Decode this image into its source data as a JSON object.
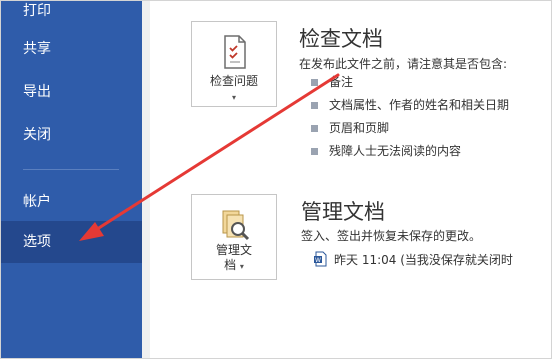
{
  "sidebar": {
    "items": [
      {
        "label": "打印"
      },
      {
        "label": "共享"
      },
      {
        "label": "导出"
      },
      {
        "label": "关闭"
      },
      {
        "label": "帐户"
      },
      {
        "label": "选项"
      }
    ],
    "selected": "选项",
    "bg_color": "#2f5caa",
    "selected_color": "#24488d"
  },
  "inspect": {
    "tile_label": "检查问题",
    "title": "检查文档",
    "description": "在发布此文件之前，请注意其是否包含:",
    "bullets": [
      "备注",
      "文档属性、作者的姓名和相关日期",
      "页眉和页脚",
      "残障人士无法阅读的内容"
    ]
  },
  "manage": {
    "tile_label_line1": "管理文",
    "tile_label_line2": "档",
    "title": "管理文档",
    "description": "签入、签出并恢复未保存的更改。",
    "file_entry": "昨天 11:04 (当我没保存就关闭时"
  },
  "annotation": {
    "arrow_color": "#e53935"
  },
  "icons": [
    "document-check-icon",
    "document-manage-icon",
    "word-file-icon",
    "caret-down-icon"
  ]
}
